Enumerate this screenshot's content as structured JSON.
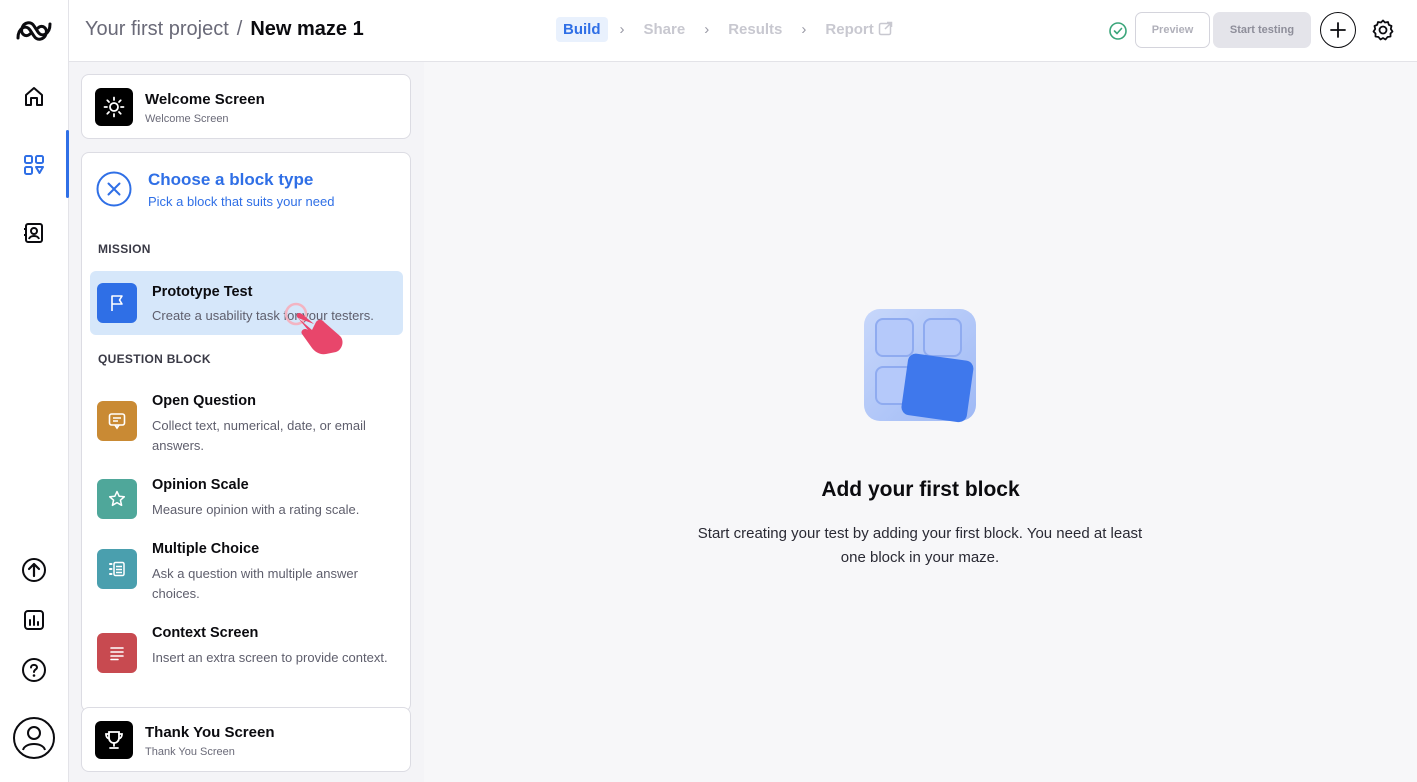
{
  "header": {
    "project": "Your first project",
    "separator": "/",
    "maze_name": "New maze 1",
    "steps": [
      {
        "label": "Build",
        "active": true
      },
      {
        "label": "Share",
        "active": false
      },
      {
        "label": "Results",
        "active": false
      },
      {
        "label": "Report",
        "active": false
      }
    ],
    "preview_label": "Preview",
    "start_label": "Start testing"
  },
  "rail": {
    "top_icons": [
      "home-icon",
      "dashboard-icon",
      "contacts-icon"
    ],
    "bottom_icons": [
      "upload-icon",
      "analytics-icon",
      "help-icon",
      "profile-icon"
    ]
  },
  "panel": {
    "welcome": {
      "title": "Welcome Screen",
      "subtitle": "Welcome Screen"
    },
    "chooser": {
      "title": "Choose a block type",
      "subtitle": "Pick a block that suits your need",
      "mission_label": "MISSION",
      "question_label": "QUESTION BLOCK",
      "blocks": [
        {
          "title": "Prototype Test",
          "desc": "Create a usability task for your testers.",
          "color": "#2f6fe6"
        },
        {
          "title": "Open Question",
          "desc": "Collect text, numerical, date, or email answers.",
          "color": "#c98a34"
        },
        {
          "title": "Opinion Scale",
          "desc": "Measure opinion with a rating scale.",
          "color": "#4fa79a"
        },
        {
          "title": "Multiple Choice",
          "desc": "Ask a question with multiple answer choices.",
          "color": "#4a9fae"
        },
        {
          "title": "Context Screen",
          "desc": "Insert an extra screen to provide context.",
          "color": "#c84a50"
        }
      ]
    },
    "thanks": {
      "title": "Thank You Screen",
      "subtitle": "Thank You Screen"
    }
  },
  "main": {
    "headline": "Add your first block",
    "description": "Start creating your test by adding your first block. You need at least one block in your maze."
  },
  "colors": {
    "accent": "#2f6fe6",
    "selected_bg": "#d6e7fa",
    "cursor": "#e8466b"
  }
}
